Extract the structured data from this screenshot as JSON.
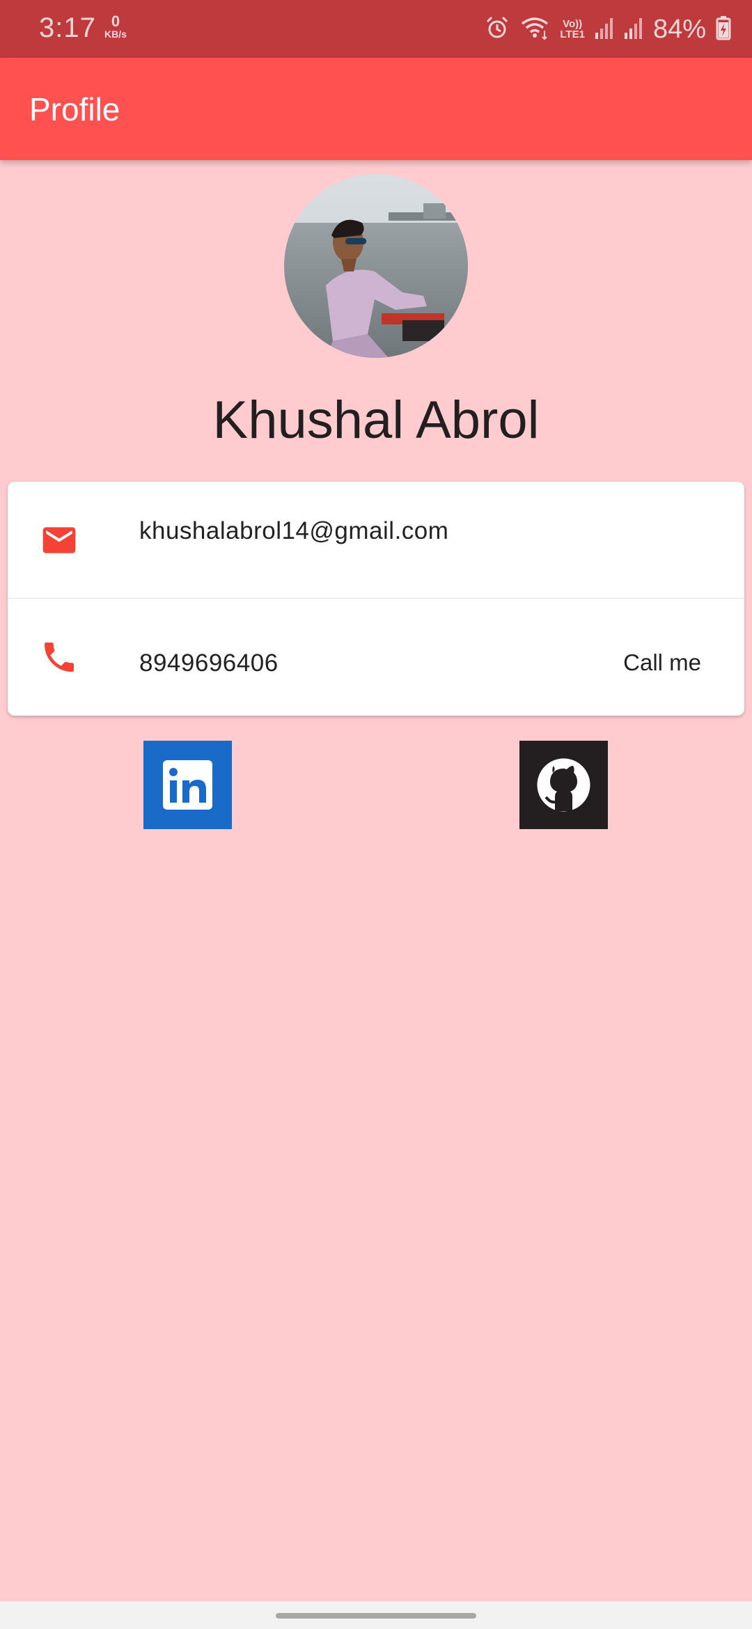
{
  "status_bar": {
    "time": "3:17",
    "speed_value": "0",
    "speed_unit": "KB/s",
    "lte_top": "Vo))",
    "lte_bottom": "LTE1",
    "battery": "84%",
    "icons": [
      "alarm-icon",
      "wifi-icon",
      "signal-icon",
      "battery-charging-icon"
    ]
  },
  "app_bar": {
    "title": "Profile"
  },
  "profile": {
    "name": "Khushal Abrol"
  },
  "contact": {
    "email": "khushalabrol14@gmail.com",
    "phone": "8949696406",
    "call_label": "Call me"
  },
  "social": [
    "linkedin",
    "github"
  ],
  "colors": {
    "status_bar": "#bf3a3d",
    "app_bar": "#ff5250",
    "background": "#fecbcf",
    "icon_red": "#f44336",
    "linkedin": "#1a6bc7",
    "github": "#231f20"
  }
}
